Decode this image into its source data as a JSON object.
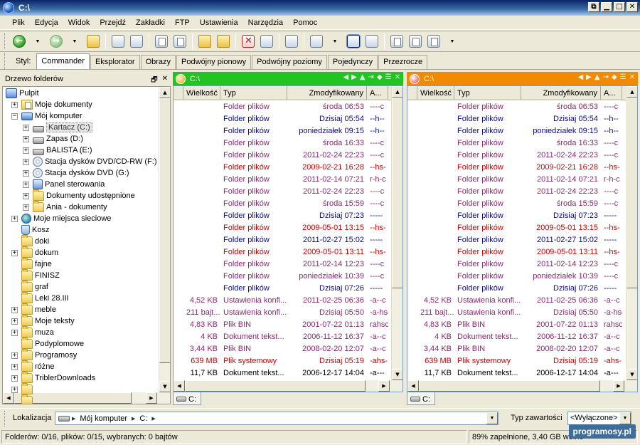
{
  "window": {
    "title": "C:\\",
    "btn_restore": "⧉",
    "btn_min": "▁",
    "btn_max": "□",
    "btn_close": "✕"
  },
  "menu": [
    "Plik",
    "Edycja",
    "Widok",
    "Przejdź",
    "Zakładki",
    "FTP",
    "Ustawienia",
    "Narzędzia",
    "Pomoc"
  ],
  "style_bar": {
    "label": "Styl:",
    "tabs": [
      "Commander",
      "Eksplorator",
      "Obrazy",
      "Podwójny pionowy",
      "Podwójny poziomy",
      "Pojedynczy",
      "Przezrocze"
    ],
    "active": "Commander"
  },
  "tree": {
    "title": "Drzewo folderów",
    "items": [
      {
        "label": "Pulpit",
        "icon": "desktop-icon",
        "level": 0,
        "expander": ""
      },
      {
        "label": "Moje dokumenty",
        "icon": "documents-folder-icon",
        "level": 1,
        "expander": "+"
      },
      {
        "label": "Mój komputer",
        "icon": "computer-icon",
        "level": 1,
        "expander": "−"
      },
      {
        "label": "Kartacz (C:)",
        "icon": "hard-drive-icon",
        "level": 2,
        "expander": "+",
        "selected": true
      },
      {
        "label": "Zapas (D:)",
        "icon": "hard-drive-icon",
        "level": 2,
        "expander": "+"
      },
      {
        "label": "BALISTA (E:)",
        "icon": "hard-drive-icon",
        "level": 2,
        "expander": "+"
      },
      {
        "label": "Stacja dysków DVD/CD-RW (F:)",
        "icon": "cd-drive-icon",
        "level": 2,
        "expander": "+"
      },
      {
        "label": "Stacja dysków DVD (G:)",
        "icon": "cd-drive-icon",
        "level": 2,
        "expander": "+"
      },
      {
        "label": "Panel sterowania",
        "icon": "control-panel-icon",
        "level": 2,
        "expander": "+"
      },
      {
        "label": "Dokumenty udostępnione",
        "icon": "folder-icon",
        "level": 2,
        "expander": "+"
      },
      {
        "label": "Ania - dokumenty",
        "icon": "folder-icon",
        "level": 2,
        "expander": "+"
      },
      {
        "label": "Moje miejsca sieciowe",
        "icon": "network-icon",
        "level": 1,
        "expander": "+"
      },
      {
        "label": "Kosz",
        "icon": "recycle-bin-icon",
        "level": 1,
        "expander": ""
      },
      {
        "label": "doki",
        "icon": "folder-icon",
        "level": 1,
        "expander": ""
      },
      {
        "label": "dokum",
        "icon": "folder-icon",
        "level": 1,
        "expander": "+"
      },
      {
        "label": "fajne",
        "icon": "folder-icon",
        "level": 1,
        "expander": ""
      },
      {
        "label": "FINISZ",
        "icon": "folder-icon",
        "level": 1,
        "expander": ""
      },
      {
        "label": "graf",
        "icon": "folder-icon",
        "level": 1,
        "expander": ""
      },
      {
        "label": "Leki 28.III",
        "icon": "folder-icon",
        "level": 1,
        "expander": ""
      },
      {
        "label": "meble",
        "icon": "folder-icon",
        "level": 1,
        "expander": "+"
      },
      {
        "label": "Moje teksty",
        "icon": "folder-icon",
        "level": 1,
        "expander": "+"
      },
      {
        "label": "muza",
        "icon": "folder-icon",
        "level": 1,
        "expander": "+"
      },
      {
        "label": "Podyplomowe",
        "icon": "folder-icon",
        "level": 1,
        "expander": ""
      },
      {
        "label": "Programosy",
        "icon": "folder-icon",
        "level": 1,
        "expander": "+"
      },
      {
        "label": "różne",
        "icon": "folder-icon",
        "level": 1,
        "expander": "+"
      },
      {
        "label": "TriblerDownloads",
        "icon": "folder-icon",
        "level": 1,
        "expander": "+"
      },
      {
        "label": "",
        "icon": "folder-icon",
        "level": 1,
        "expander": "+"
      },
      {
        "label": "",
        "icon": "folder-icon",
        "level": 1,
        "expander": ""
      }
    ]
  },
  "columns": {
    "size": "Wielkość",
    "type": "Typ",
    "modified": "Zmodyfikowany",
    "attr": "A..."
  },
  "colors": {
    "left_header": "#21c421",
    "right_header": "#f28a00",
    "blue": "#0a0a8c",
    "purple": "#8a2a6e",
    "red": "#cc0000",
    "black": "#000000"
  },
  "left_pane": {
    "title": "C:\\",
    "drive_tab": "C:"
  },
  "right_pane": {
    "title": "C:\\",
    "drive_tab": "C:"
  },
  "files": [
    {
      "size": "",
      "type": "Folder plików",
      "date": "środa 06:53",
      "attr": "----c",
      "color": "purple"
    },
    {
      "size": "",
      "type": "Folder plików",
      "date": "Dzisiaj 05:54",
      "attr": "--h--",
      "color": "blue"
    },
    {
      "size": "",
      "type": "Folder plików",
      "date": "poniedziałek 09:15",
      "attr": "--h--",
      "color": "blue"
    },
    {
      "size": "",
      "type": "Folder plików",
      "date": "środa 16:33",
      "attr": "----c",
      "color": "purple"
    },
    {
      "size": "",
      "type": "Folder plików",
      "date": "2011-02-24 22:23",
      "attr": "----c",
      "color": "purple"
    },
    {
      "size": "",
      "type": "Folder plików",
      "date": "2009-02-21 16:28",
      "attr": "--hs-",
      "color": "red"
    },
    {
      "size": "",
      "type": "Folder plików",
      "date": "2011-02-14 07:21",
      "attr": "r-h-c",
      "color": "purple"
    },
    {
      "size": "",
      "type": "Folder plików",
      "date": "2011-02-24 22:23",
      "attr": "----c",
      "color": "purple"
    },
    {
      "size": "",
      "type": "Folder plików",
      "date": "środa 15:59",
      "attr": "----c",
      "color": "purple"
    },
    {
      "size": "",
      "type": "Folder plików",
      "date": "Dzisiaj 07:23",
      "attr": "-----",
      "color": "blue"
    },
    {
      "size": "",
      "type": "Folder plików",
      "date": "2009-05-01 13:15",
      "attr": "--hs-",
      "color": "red"
    },
    {
      "size": "",
      "type": "Folder plików",
      "date": "2011-02-27 15:02",
      "attr": "-----",
      "color": "blue"
    },
    {
      "size": "",
      "type": "Folder plików",
      "date": "2009-05-01 13:11",
      "attr": "--hs-",
      "color": "red"
    },
    {
      "size": "",
      "type": "Folder plików",
      "date": "2011-02-14 12:23",
      "attr": "----c",
      "color": "purple"
    },
    {
      "size": "",
      "type": "Folder plików",
      "date": "poniedziałek 10:39",
      "attr": "----c",
      "color": "purple"
    },
    {
      "size": "",
      "type": "Folder plików",
      "date": "Dzisiaj 07:26",
      "attr": "-----",
      "color": "blue"
    },
    {
      "size": "4,52 KB",
      "type": "Ustawienia konfi...",
      "date": "2011-02-25 06:36",
      "attr": "-a--c",
      "color": "purple"
    },
    {
      "size": "211 bajt...",
      "type": "Ustawienia konfi...",
      "date": "Dzisiaj 05:50",
      "attr": "-a-hsc",
      "color": "purple"
    },
    {
      "size": "4,83 KB",
      "type": "Plik BIN",
      "date": "2001-07-22 01:13",
      "attr": "rahsc",
      "color": "purple"
    },
    {
      "size": "4 KB",
      "type": "Dokument tekst...",
      "date": "2006-11-12 16:37",
      "attr": "-a--c",
      "color": "purple"
    },
    {
      "size": "3,44 KB",
      "type": "Plik BIN",
      "date": "2008-02-20 12:07",
      "attr": "-a--c",
      "color": "purple"
    },
    {
      "size": "639 MB",
      "type": "Plik systemowy",
      "date": "Dzisiaj 05:19",
      "attr": "-ahs-",
      "color": "red"
    },
    {
      "size": "11,7 KB",
      "type": "Dokument tekst...",
      "date": "2006-12-17 14:04",
      "attr": "-a---",
      "color": "black"
    }
  ],
  "location": {
    "label": "Lokalizacja",
    "path": [
      "Mój komputer",
      "C:"
    ],
    "content_type_label": "Typ zawartości",
    "content_type_value": "<Wyłączone>"
  },
  "status": {
    "left": "Folderów: 0/16, plików: 0/15, wybranych: 0 bajtów",
    "right": "89% zapełnione, 3,40 GB wolne"
  },
  "watermark": "programosy.pl"
}
